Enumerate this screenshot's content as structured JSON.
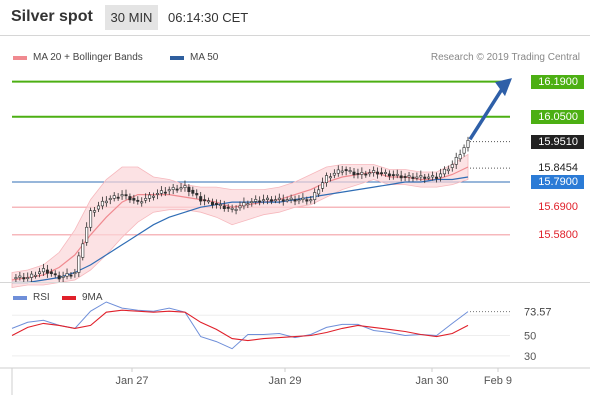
{
  "header": {
    "title": "Silver spot",
    "timeframe": "30 MIN",
    "time": "06:14:30 CET"
  },
  "legend": {
    "ma20_bb": "MA 20 + Bollinger Bands",
    "ma50": "MA 50",
    "credit": "Research © 2019 Trading Central"
  },
  "colors": {
    "green": "#4caf13",
    "blue_ma50": "#2f6db5",
    "red": "#e0202a",
    "pink": "#f4a0a6",
    "candle": "#2c2c2c",
    "arrow": "#2e5fa8",
    "rsi": "#6f8fd9",
    "rsi_ma": "#e0202a"
  },
  "chart_data": [
    {
      "type": "line",
      "title": "Silver spot",
      "x_ticks": [
        "Jan 27",
        "Jan 29",
        "Jan 30",
        "Feb 9"
      ],
      "ylim": [
        15.4,
        16.26
      ],
      "levels": [
        {
          "label": "16.1900",
          "value": 16.19,
          "kind": "target"
        },
        {
          "label": "16.0500",
          "value": 16.05,
          "kind": "target"
        },
        {
          "label": "15.9510",
          "value": 15.951,
          "kind": "current"
        },
        {
          "label": "15.8454",
          "value": 15.8454,
          "kind": "ma20"
        },
        {
          "label": "15.7900",
          "value": 15.79,
          "kind": "pivot"
        },
        {
          "label": "15.6900",
          "value": 15.69,
          "kind": "support"
        },
        {
          "label": "15.5800",
          "value": 15.58,
          "kind": "support"
        }
      ],
      "series": [
        {
          "name": "MA 20 + Bollinger Bands",
          "role": "ma20",
          "values": [
            15.4,
            15.41,
            15.42,
            15.45,
            15.5,
            15.58,
            15.65,
            15.71,
            15.74,
            15.74,
            15.74,
            15.73,
            15.72,
            15.71,
            15.69,
            15.7,
            15.71,
            15.72,
            15.74,
            15.76,
            15.79,
            15.81,
            15.82,
            15.83,
            15.81,
            15.81,
            15.8,
            15.8,
            15.82,
            15.85
          ]
        },
        {
          "name": "MA 50",
          "role": "ma50",
          "values": [
            15.39,
            15.39,
            15.4,
            15.41,
            15.43,
            15.46,
            15.5,
            15.54,
            15.58,
            15.62,
            15.65,
            15.67,
            15.69,
            15.7,
            15.71,
            15.71,
            15.71,
            15.71,
            15.72,
            15.73,
            15.74,
            15.75,
            15.76,
            15.77,
            15.78,
            15.79,
            15.79,
            15.8,
            15.8,
            15.81
          ]
        },
        {
          "name": "Price",
          "role": "price",
          "values": [
            15.41,
            15.41,
            15.44,
            15.41,
            15.43,
            15.67,
            15.72,
            15.74,
            15.71,
            15.74,
            15.76,
            15.77,
            15.72,
            15.7,
            15.68,
            15.71,
            15.72,
            15.72,
            15.72,
            15.72,
            15.81,
            15.84,
            15.82,
            15.83,
            15.82,
            15.81,
            15.81,
            15.81,
            15.86,
            15.95
          ]
        }
      ]
    },
    {
      "type": "line",
      "title": "",
      "x_ticks": [
        "Jan 27",
        "Jan 29",
        "Jan 30",
        "Feb 9"
      ],
      "ylim": [
        20,
        85
      ],
      "y_ticks": [
        73.57,
        50,
        30
      ],
      "levels": [
        {
          "label": "73.57",
          "value": 73.57,
          "kind": "current"
        }
      ],
      "series": [
        {
          "name": "RSI",
          "values": [
            57,
            63,
            65,
            60,
            57,
            74,
            83,
            77,
            75,
            74,
            77,
            73,
            49,
            44,
            37,
            51,
            51,
            52,
            48,
            51,
            58,
            61,
            61,
            55,
            53,
            50,
            51,
            50,
            62,
            73.57
          ]
        },
        {
          "name": "9MA",
          "values": [
            50,
            58,
            62,
            60,
            57,
            60,
            73,
            75,
            74,
            73,
            74,
            73,
            63,
            56,
            47,
            45,
            47,
            48,
            49,
            50,
            53,
            57,
            60,
            58,
            56,
            54,
            51,
            49,
            52,
            60
          ]
        }
      ]
    }
  ]
}
